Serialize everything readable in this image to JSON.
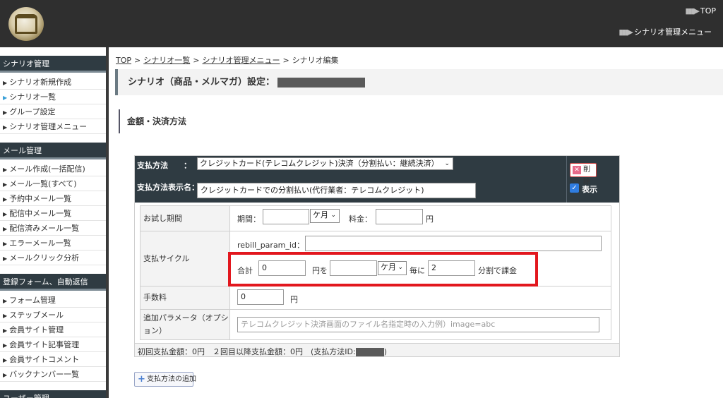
{
  "header": {
    "top_link": "TOP",
    "menu_link": "シナリオ管理メニュー"
  },
  "sidebar": {
    "sections": [
      {
        "title": "シナリオ管理",
        "items": [
          "シナリオ新規作成",
          "シナリオ一覧",
          "グループ設定",
          "シナリオ管理メニュー"
        ]
      },
      {
        "title": "メール管理",
        "items": [
          "メール作成(一括配信)",
          "メール一覧(すべて)",
          "予約中メール一覧",
          "配信中メール一覧",
          "配信済みメール一覧",
          "エラーメール一覧",
          "メールクリック分析"
        ]
      },
      {
        "title": "登録フォーム、自動返信",
        "items": [
          "フォーム管理",
          "ステップメール",
          "会員サイト管理",
          "会員サイト記事管理",
          "会員サイトコメント",
          "バックナンバー一覧"
        ]
      },
      {
        "title": "ユーザー管理",
        "items": []
      }
    ],
    "active_item": "シナリオ一覧"
  },
  "breadcrumb": {
    "items": [
      "TOP",
      "シナリオ一覧",
      "シナリオ管理メニュー"
    ],
    "current": "シナリオ編集",
    "separator": ">"
  },
  "page_title": "シナリオ（商品・メルマガ）設定：",
  "section_title": "金額・決済方法",
  "payment": {
    "method_label": "支払方法　　：",
    "method_value": "クレジットカード(テレコムクレジット)決済（分割払い：継続決済）",
    "display_name_label": "支払方法表示名：",
    "display_name_value": "クレジットカードでの分割払い(代行業者：テレコムクレジット)",
    "delete_label": "削除",
    "show_label": "表示",
    "trial": {
      "label": "お試し期間",
      "period_label": "期間：",
      "period_value": "",
      "unit_value": "ケ月",
      "fee_label": "料金：",
      "fee_value": "",
      "yen": "円"
    },
    "cycle": {
      "label": "支払サイクル",
      "param_label": "rebill_param_id：",
      "param_value": "",
      "total_label": "合計",
      "total_value": "0",
      "yen_wo": "円を",
      "interval_value": "",
      "interval_unit": "ケ月",
      "every_label": "毎に",
      "count_value": "2",
      "split_label": "分割で課金"
    },
    "fee": {
      "label": "手数料",
      "value": "0",
      "yen": "円"
    },
    "extra": {
      "label": "追加パラメータ（オプション）",
      "placeholder": "テレコムクレジット決済画面のファイル名指定時の入力例）image=abc"
    },
    "summary": "初回支払金額：0円　２回目以降支払金額：0円　(支払方法ID:",
    "summary_end": ")"
  },
  "add_button": "支払方法の追加",
  "colors": {
    "header_bg": "#2f2f2f",
    "panel_head": "#2f3b42",
    "highlight": "#e2171e"
  }
}
